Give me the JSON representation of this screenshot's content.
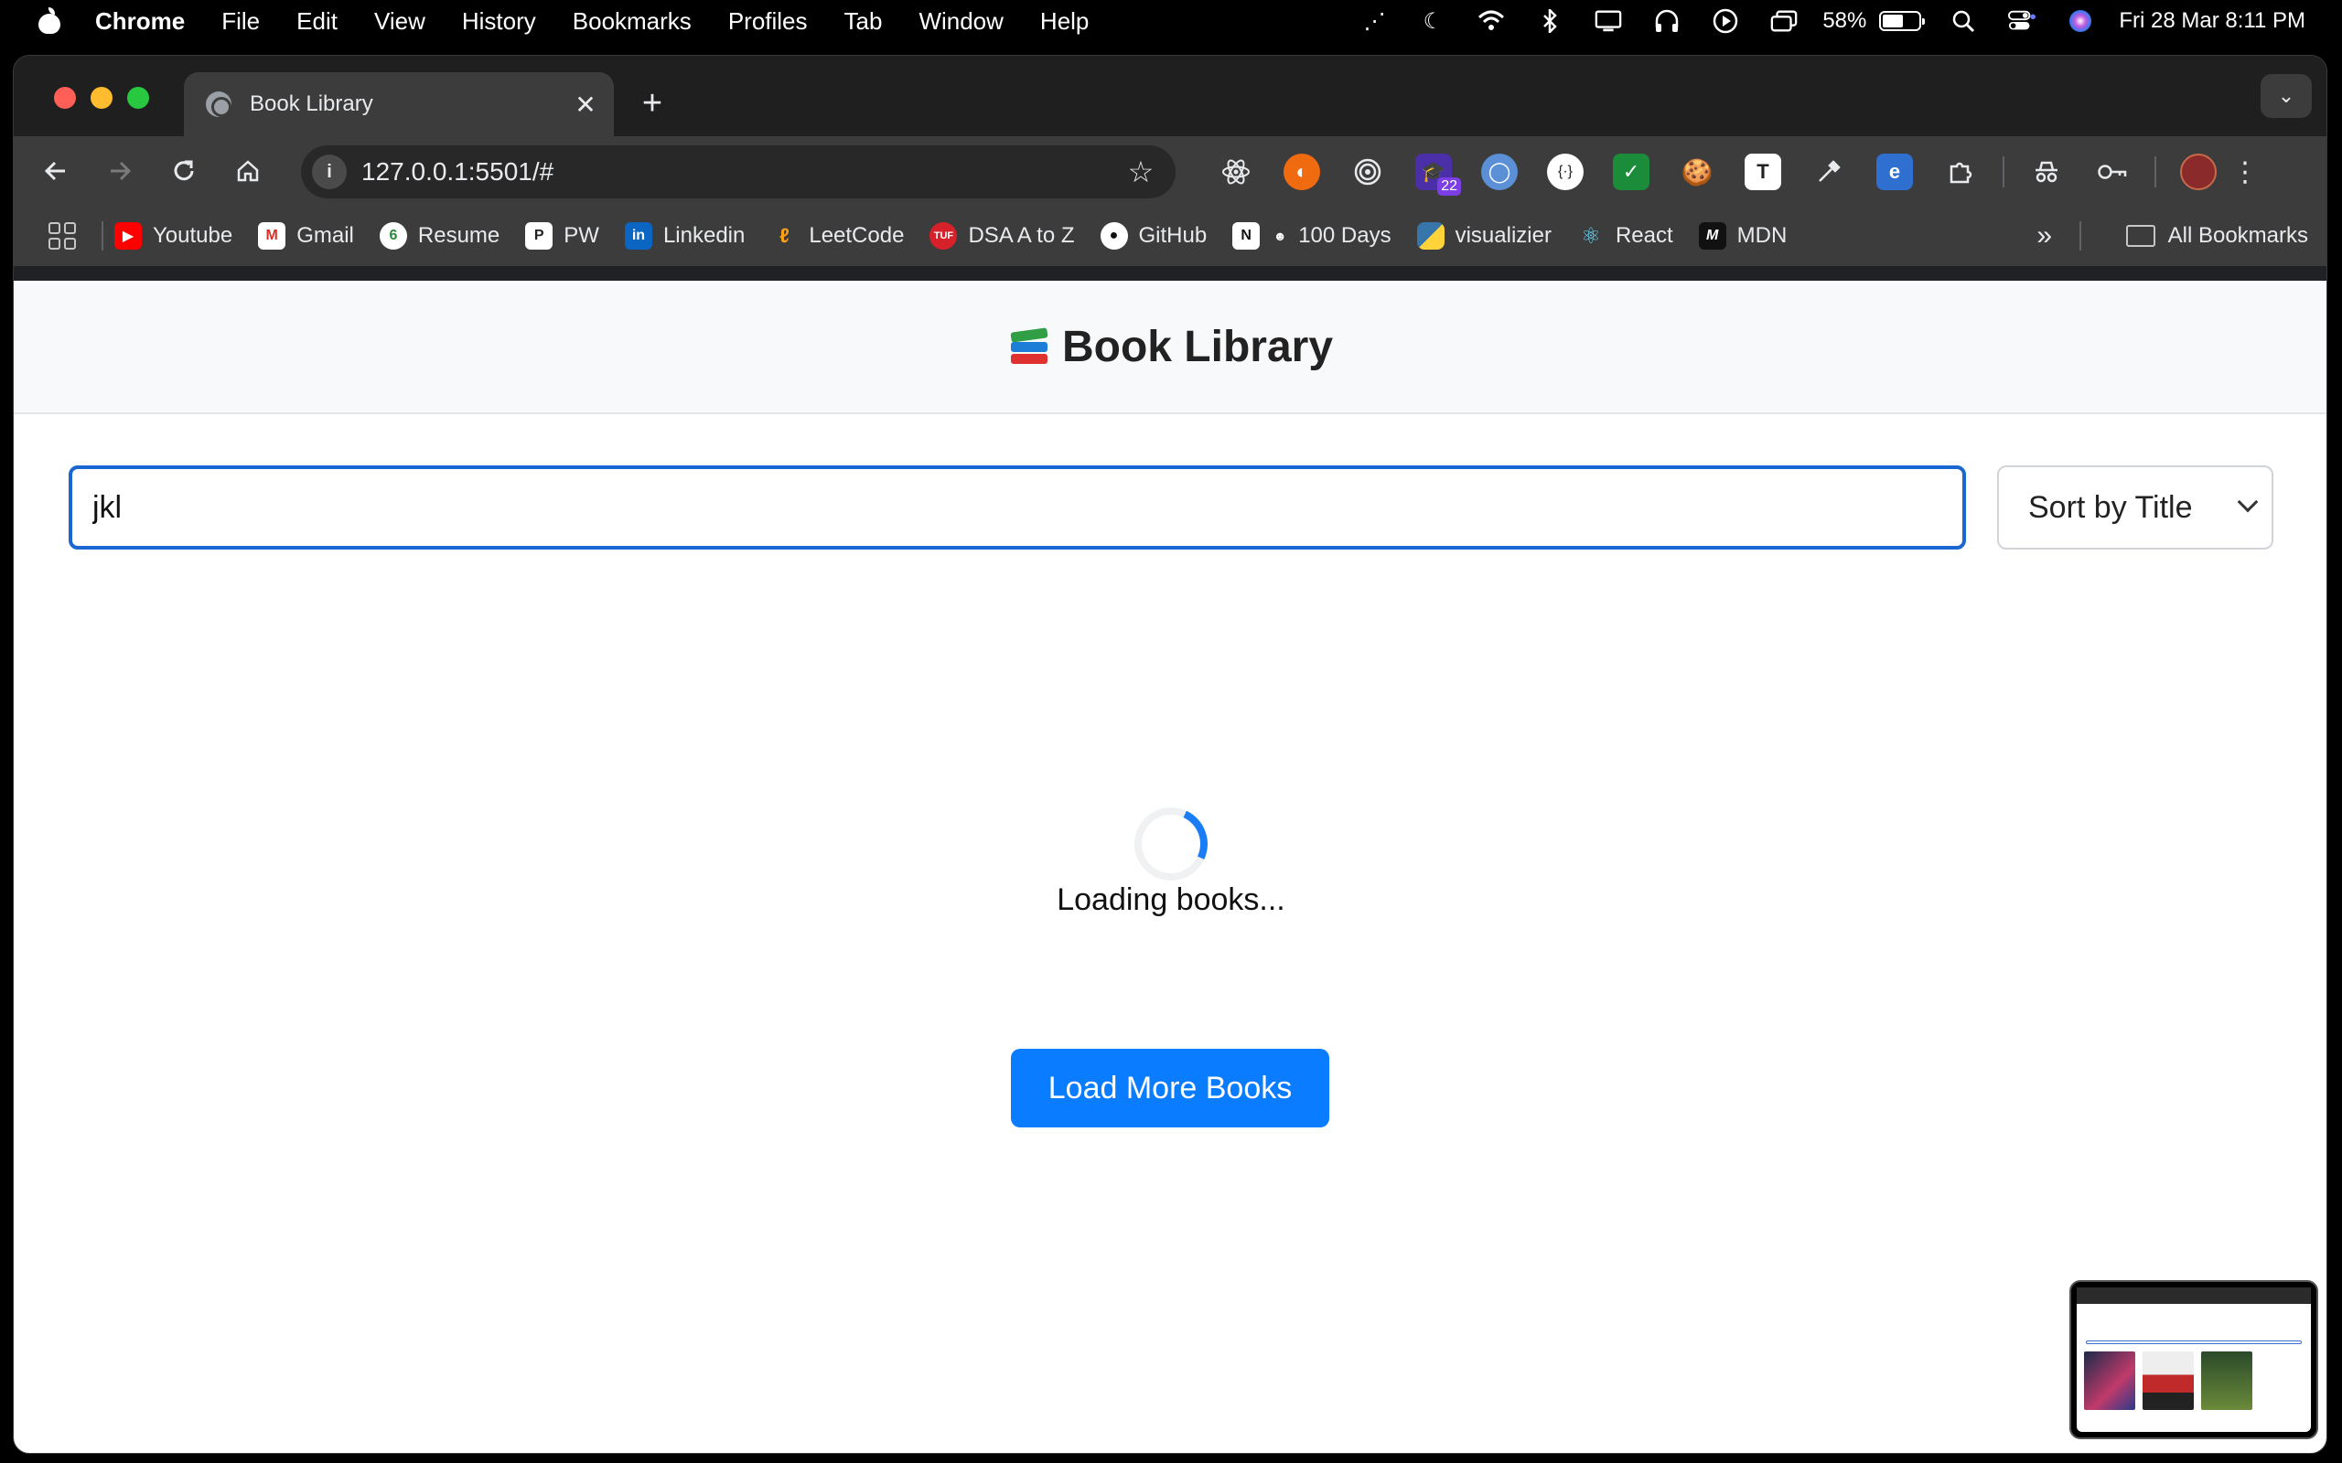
{
  "menubar": {
    "app": "Chrome",
    "items": [
      "File",
      "Edit",
      "View",
      "History",
      "Bookmarks",
      "Profiles",
      "Tab",
      "Window",
      "Help"
    ],
    "battery": "58%",
    "datetime": "Fri 28 Mar  8:11 PM"
  },
  "tab": {
    "title": "Book Library"
  },
  "omnibox": {
    "url": "127.0.0.1:5501/#"
  },
  "extensions": {
    "badge": "22"
  },
  "bookmarks": {
    "items": [
      "Youtube",
      "Gmail",
      "Resume",
      "PW",
      "Linkedin",
      "LeetCode",
      "DSA A to Z",
      "GitHub",
      "100 Days",
      "visualizier",
      "React",
      "MDN"
    ],
    "all": "All Bookmarks"
  },
  "page": {
    "title": "Book Library",
    "search": {
      "value": "jkl"
    },
    "sort": {
      "selected": "Sort by Title"
    },
    "loading_text": "Loading books...",
    "load_more_label": "Load More Books"
  },
  "colors": {
    "accent": "#0a7cff",
    "focus_border": "#1a66d2",
    "spinner": "#1a7df5"
  }
}
